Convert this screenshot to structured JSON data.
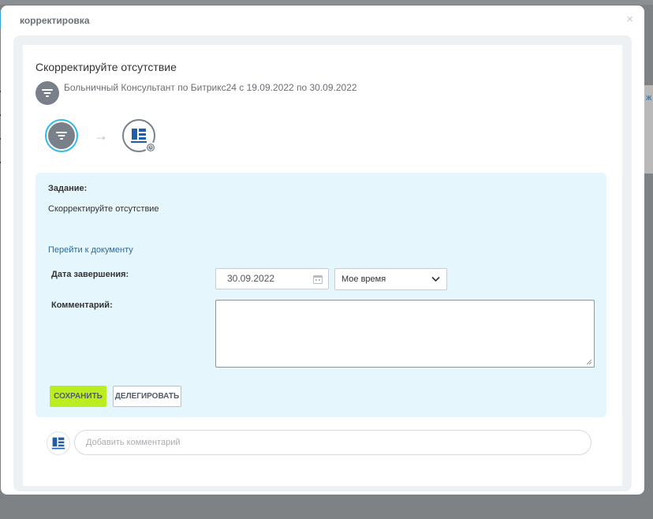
{
  "modal": {
    "title": "корректировка",
    "close_symbol": "×"
  },
  "task": {
    "title": "Скорректируйте отсутствие",
    "info": "Больничный Консультант по Битрикс24 с 19.09.2022 по 30.09.2022"
  },
  "flow": {
    "arrow": "→",
    "start_icon": "filter-icon",
    "end_icon": "company-logo-icon",
    "status_icon": "clock-icon"
  },
  "task_box": {
    "task_label": "Задание:",
    "task_description": "Скорректируйте отсутствие",
    "document_link": "Перейти к документу",
    "date_label": "Дата завершения:",
    "date_value": "30.09.2022",
    "time_select_value": "Мое время",
    "comment_label": "Комментарий:",
    "comment_value": "",
    "save_button": "СОХРАНИТЬ",
    "delegate_button": "ДЕЛЕГИРОВАТЬ"
  },
  "comments": {
    "placeholder": "Добавить комментарий"
  },
  "background": {
    "right_edge_text": "ж"
  },
  "colors": {
    "accent_blue": "#31b9ea",
    "save_green": "#bbed21",
    "task_box_bg": "#e5f6fd",
    "link_blue": "#2d6a9a",
    "icon_grey": "#79808a"
  }
}
